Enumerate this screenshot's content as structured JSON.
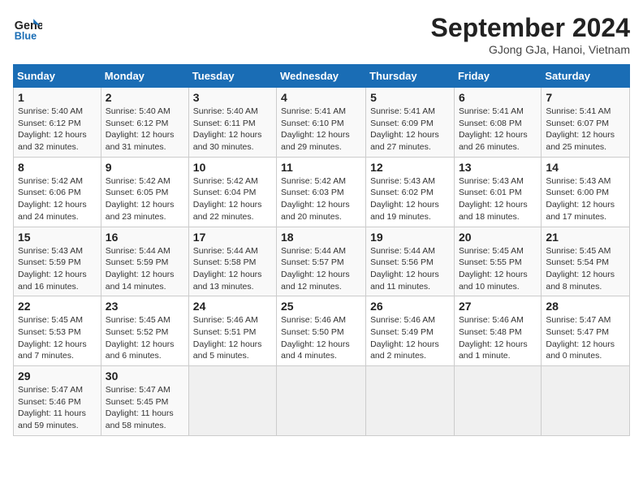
{
  "header": {
    "logo_line1": "General",
    "logo_line2": "Blue",
    "month": "September 2024",
    "location": "GJong GJa, Hanoi, Vietnam"
  },
  "weekdays": [
    "Sunday",
    "Monday",
    "Tuesday",
    "Wednesday",
    "Thursday",
    "Friday",
    "Saturday"
  ],
  "weeks": [
    [
      {
        "day": "1",
        "detail": "Sunrise: 5:40 AM\nSunset: 6:12 PM\nDaylight: 12 hours\nand 32 minutes."
      },
      {
        "day": "2",
        "detail": "Sunrise: 5:40 AM\nSunset: 6:12 PM\nDaylight: 12 hours\nand 31 minutes."
      },
      {
        "day": "3",
        "detail": "Sunrise: 5:40 AM\nSunset: 6:11 PM\nDaylight: 12 hours\nand 30 minutes."
      },
      {
        "day": "4",
        "detail": "Sunrise: 5:41 AM\nSunset: 6:10 PM\nDaylight: 12 hours\nand 29 minutes."
      },
      {
        "day": "5",
        "detail": "Sunrise: 5:41 AM\nSunset: 6:09 PM\nDaylight: 12 hours\nand 27 minutes."
      },
      {
        "day": "6",
        "detail": "Sunrise: 5:41 AM\nSunset: 6:08 PM\nDaylight: 12 hours\nand 26 minutes."
      },
      {
        "day": "7",
        "detail": "Sunrise: 5:41 AM\nSunset: 6:07 PM\nDaylight: 12 hours\nand 25 minutes."
      }
    ],
    [
      {
        "day": "8",
        "detail": "Sunrise: 5:42 AM\nSunset: 6:06 PM\nDaylight: 12 hours\nand 24 minutes."
      },
      {
        "day": "9",
        "detail": "Sunrise: 5:42 AM\nSunset: 6:05 PM\nDaylight: 12 hours\nand 23 minutes."
      },
      {
        "day": "10",
        "detail": "Sunrise: 5:42 AM\nSunset: 6:04 PM\nDaylight: 12 hours\nand 22 minutes."
      },
      {
        "day": "11",
        "detail": "Sunrise: 5:42 AM\nSunset: 6:03 PM\nDaylight: 12 hours\nand 20 minutes."
      },
      {
        "day": "12",
        "detail": "Sunrise: 5:43 AM\nSunset: 6:02 PM\nDaylight: 12 hours\nand 19 minutes."
      },
      {
        "day": "13",
        "detail": "Sunrise: 5:43 AM\nSunset: 6:01 PM\nDaylight: 12 hours\nand 18 minutes."
      },
      {
        "day": "14",
        "detail": "Sunrise: 5:43 AM\nSunset: 6:00 PM\nDaylight: 12 hours\nand 17 minutes."
      }
    ],
    [
      {
        "day": "15",
        "detail": "Sunrise: 5:43 AM\nSunset: 5:59 PM\nDaylight: 12 hours\nand 16 minutes."
      },
      {
        "day": "16",
        "detail": "Sunrise: 5:44 AM\nSunset: 5:59 PM\nDaylight: 12 hours\nand 14 minutes."
      },
      {
        "day": "17",
        "detail": "Sunrise: 5:44 AM\nSunset: 5:58 PM\nDaylight: 12 hours\nand 13 minutes."
      },
      {
        "day": "18",
        "detail": "Sunrise: 5:44 AM\nSunset: 5:57 PM\nDaylight: 12 hours\nand 12 minutes."
      },
      {
        "day": "19",
        "detail": "Sunrise: 5:44 AM\nSunset: 5:56 PM\nDaylight: 12 hours\nand 11 minutes."
      },
      {
        "day": "20",
        "detail": "Sunrise: 5:45 AM\nSunset: 5:55 PM\nDaylight: 12 hours\nand 10 minutes."
      },
      {
        "day": "21",
        "detail": "Sunrise: 5:45 AM\nSunset: 5:54 PM\nDaylight: 12 hours\nand 8 minutes."
      }
    ],
    [
      {
        "day": "22",
        "detail": "Sunrise: 5:45 AM\nSunset: 5:53 PM\nDaylight: 12 hours\nand 7 minutes."
      },
      {
        "day": "23",
        "detail": "Sunrise: 5:45 AM\nSunset: 5:52 PM\nDaylight: 12 hours\nand 6 minutes."
      },
      {
        "day": "24",
        "detail": "Sunrise: 5:46 AM\nSunset: 5:51 PM\nDaylight: 12 hours\nand 5 minutes."
      },
      {
        "day": "25",
        "detail": "Sunrise: 5:46 AM\nSunset: 5:50 PM\nDaylight: 12 hours\nand 4 minutes."
      },
      {
        "day": "26",
        "detail": "Sunrise: 5:46 AM\nSunset: 5:49 PM\nDaylight: 12 hours\nand 2 minutes."
      },
      {
        "day": "27",
        "detail": "Sunrise: 5:46 AM\nSunset: 5:48 PM\nDaylight: 12 hours\nand 1 minute."
      },
      {
        "day": "28",
        "detail": "Sunrise: 5:47 AM\nSunset: 5:47 PM\nDaylight: 12 hours\nand 0 minutes."
      }
    ],
    [
      {
        "day": "29",
        "detail": "Sunrise: 5:47 AM\nSunset: 5:46 PM\nDaylight: 11 hours\nand 59 minutes."
      },
      {
        "day": "30",
        "detail": "Sunrise: 5:47 AM\nSunset: 5:45 PM\nDaylight: 11 hours\nand 58 minutes."
      },
      {
        "day": "",
        "detail": ""
      },
      {
        "day": "",
        "detail": ""
      },
      {
        "day": "",
        "detail": ""
      },
      {
        "day": "",
        "detail": ""
      },
      {
        "day": "",
        "detail": ""
      }
    ]
  ]
}
